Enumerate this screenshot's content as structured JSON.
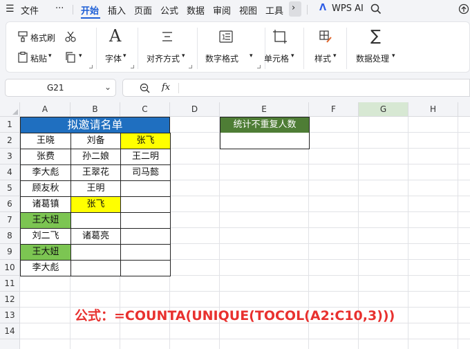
{
  "menu": {
    "file": "文件",
    "more": "···",
    "tabs": [
      "开始",
      "插入",
      "页面",
      "公式",
      "数据",
      "审阅",
      "视图",
      "工具"
    ],
    "wps_ai": "WPS AI"
  },
  "ribbon": {
    "format_painter": "格式刷",
    "paste": "粘贴",
    "font": "字体",
    "align": "对齐方式",
    "number_format": "数字格式",
    "cell": "单元格",
    "style": "样式",
    "data_process": "数据处理"
  },
  "formula_bar": {
    "cell_ref": "G21",
    "fx": "fx",
    "value": ""
  },
  "columns": [
    "A",
    "B",
    "C",
    "D",
    "E",
    "F",
    "G",
    "H"
  ],
  "rows": [
    "1",
    "2",
    "3",
    "4",
    "5",
    "6",
    "7",
    "8",
    "9",
    "10",
    "11",
    "12",
    "13",
    "14"
  ],
  "sheet": {
    "title": "拟邀请名单",
    "stat_header": "统计不重复人数",
    "cells": {
      "A2": "王晓",
      "B2": "刘备",
      "C2": "张飞",
      "A3": "张费",
      "B3": "孙二娘",
      "C3": "王二明",
      "A4": "李大彪",
      "B4": "王翠花",
      "C4": "司马懿",
      "A5": "顾友秋",
      "B5": "王明",
      "A6": "诸葛镇",
      "B6": "张飞",
      "A7": "王大妞",
      "A8": "刘二飞",
      "B8": "诸葛亮",
      "A9": "王大妞",
      "A10": "李大彪"
    },
    "formula_note": "公式：=COUNTA(UNIQUE(TOCOL(A2:C10,3)))"
  },
  "colors": {
    "title_fill": "#1f6fc0",
    "stat_fill": "#4e7d35",
    "yellow": "#ffff00",
    "green": "#7cc552",
    "accent": "#1e5fd6",
    "formula_text": "#e8312f"
  }
}
